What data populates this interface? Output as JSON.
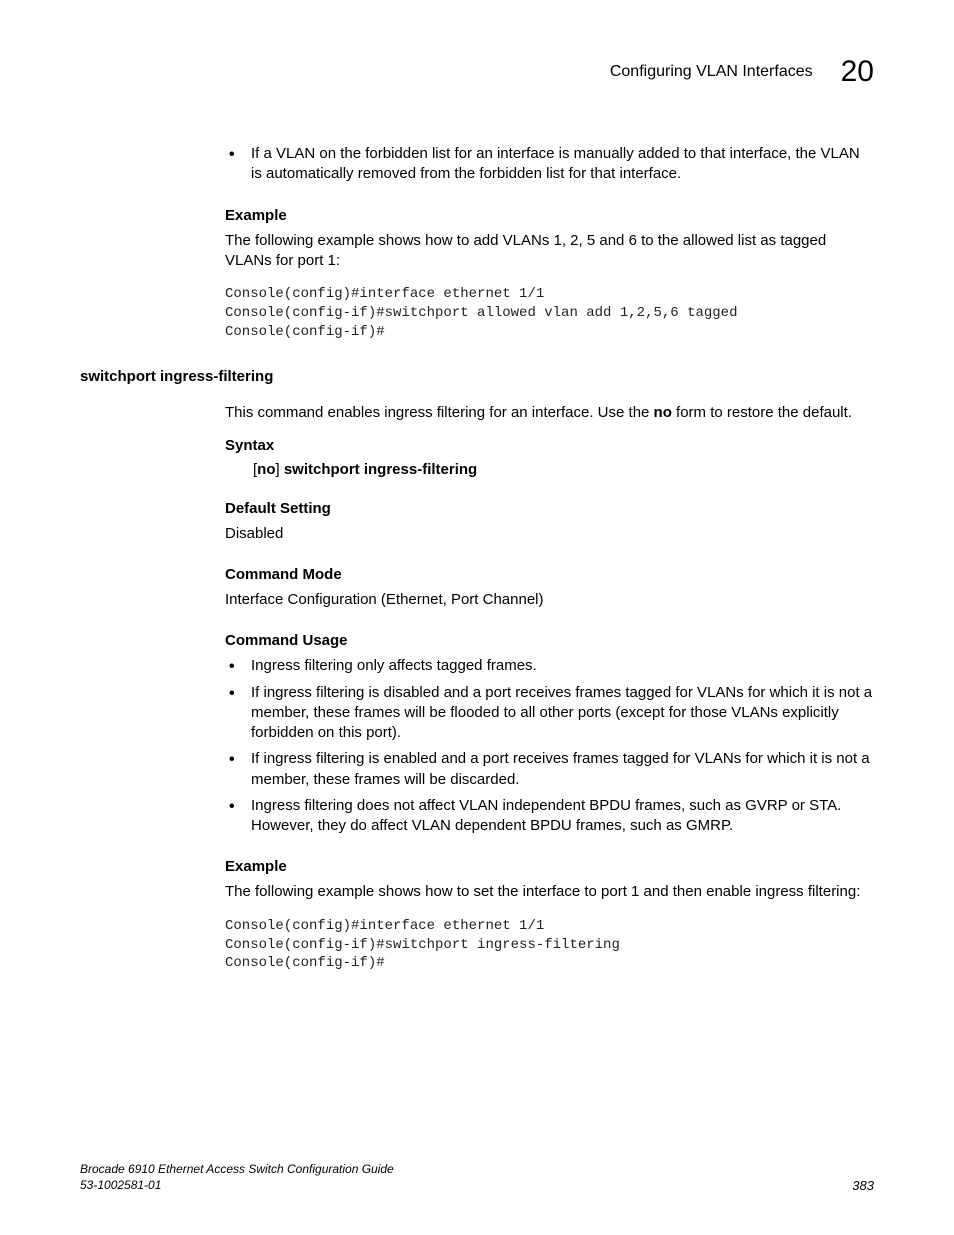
{
  "header": {
    "title": "Configuring VLAN Interfaces",
    "chapter": "20"
  },
  "top_bullet": "If a VLAN on the forbidden list for an interface is manually added to that interface, the VLAN is automatically removed from the forbidden list for that interface.",
  "example1": {
    "heading": "Example",
    "para": "The following example shows how to add VLANs 1, 2, 5 and 6 to the allowed list as tagged VLANs for port 1:",
    "console": "Console(config)#interface ethernet 1/1\nConsole(config-if)#switchport allowed vlan add 1,2,5,6 tagged\nConsole(config-if)#"
  },
  "section": {
    "heading": "switchport ingress-filtering",
    "intro_pre": "This command enables ingress filtering for an interface. Use the ",
    "intro_bold": "no",
    "intro_post": " form to restore the default.",
    "syntax_heading": "Syntax",
    "syntax_pre": "[",
    "syntax_bold1": "no",
    "syntax_mid": "] ",
    "syntax_bold2": "switchport ingress-filtering",
    "default_heading": "Default Setting",
    "default_value": "Disabled",
    "mode_heading": "Command Mode",
    "mode_value": "Interface Configuration (Ethernet, Port Channel)",
    "usage_heading": "Command Usage",
    "usage_items": [
      "Ingress filtering only affects tagged frames.",
      "If ingress filtering is disabled and a port receives frames tagged for VLANs for which it is not a member, these frames will be flooded to all other ports (except for those VLANs explicitly forbidden on this port).",
      "If ingress filtering is enabled and a port receives frames tagged for VLANs for which it is not a member, these frames will be discarded.",
      "Ingress filtering does not affect VLAN independent BPDU frames, such as GVRP or STA. However, they do affect VLAN dependent BPDU frames, such as GMRP."
    ],
    "example2_heading": "Example",
    "example2_para": "The following example shows how to set the interface to port 1 and then enable ingress filtering:",
    "example2_console": "Console(config)#interface ethernet 1/1\nConsole(config-if)#switchport ingress-filtering\nConsole(config-if)#"
  },
  "footer": {
    "line1": "Brocade 6910 Ethernet Access Switch Configuration Guide",
    "line2": "53-1002581-01",
    "page": "383"
  }
}
